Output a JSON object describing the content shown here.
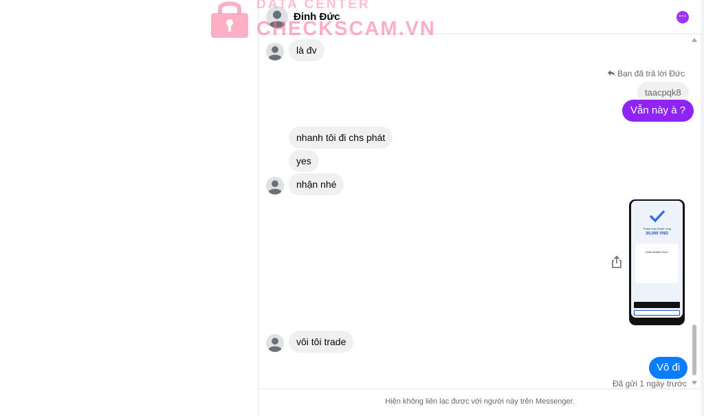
{
  "header": {
    "contact_name": "Đinh Đức"
  },
  "watermark": {
    "line1": "DATA CENTER",
    "line2": "CHECKSCAM.VN"
  },
  "messages": {
    "m1": "là đv",
    "reply_note": "Bạn đã trả lời Đức",
    "quoted": "taacpqk8",
    "m2": "Vẫn này à ?",
    "m3": "nhanh tôi đi chs phát",
    "m4": "yes",
    "m5": "nhận nhé",
    "m6": "vôi tôi trade",
    "m7": "Vô đi"
  },
  "receipt": {
    "title": "Thanh toán thành công",
    "amount": "30,000 VND",
    "name": "DINH MANH DUC"
  },
  "status": {
    "sent": "Đã gửi 1 ngày trước"
  },
  "footer": {
    "notice": "Hiện không liên lạc được với người này trên Messenger."
  },
  "colors": {
    "outgoing_purple": "#8e24f5",
    "outgoing_blue": "#0a7cff",
    "incoming": "#f0f0f0"
  }
}
